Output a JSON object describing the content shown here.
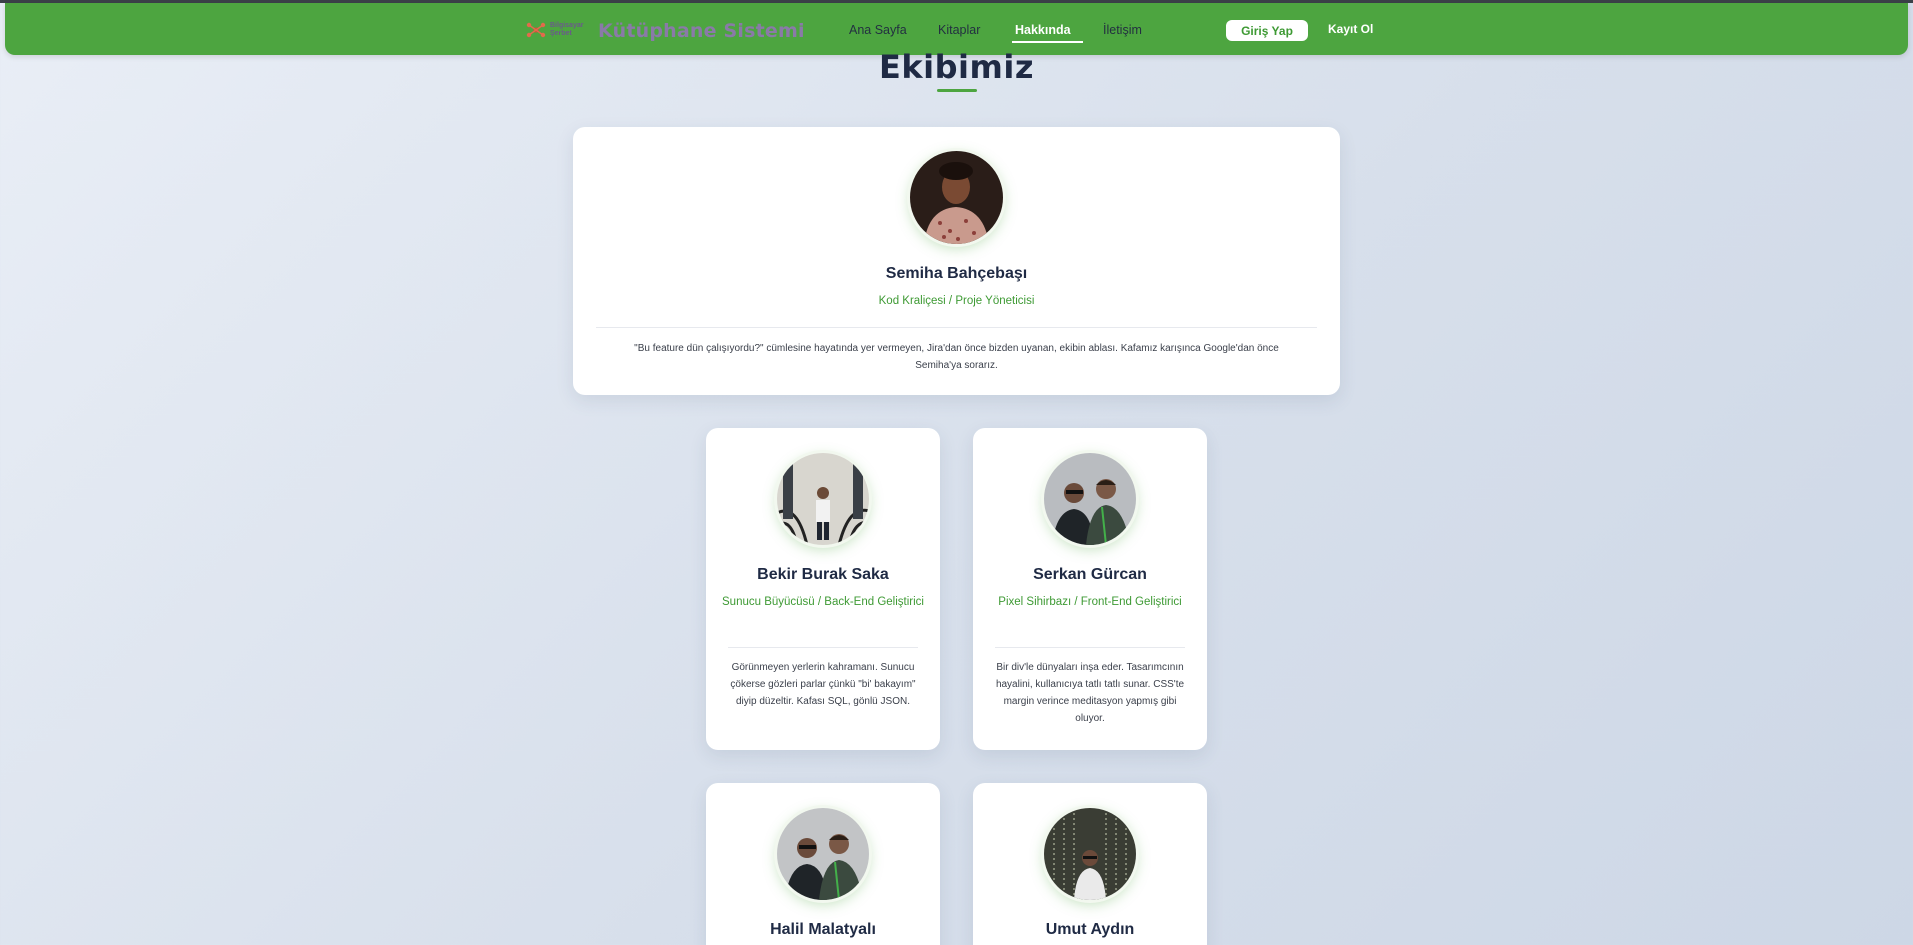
{
  "header": {
    "logo_text": "Bilgisayar Şerbet",
    "brand": "Kütüphane Sistemi",
    "nav": [
      {
        "label": "Ana Sayfa"
      },
      {
        "label": "Kitaplar"
      },
      {
        "label": "Hakkında",
        "active": true
      },
      {
        "label": "İletişim"
      }
    ],
    "login_label": "Giriş Yap",
    "register_label": "Kayıt Ol",
    "brand_color": "#4da540"
  },
  "section": {
    "title": "Ekibimiz"
  },
  "team": [
    {
      "name": "Semiha Bahçebaşı",
      "role": "Kod Kraliçesi / Proje Yöneticisi",
      "bio": "\"Bu feature dün çalışıyordu?\" cümlesine hayatında yer vermeyen, Jira'dan önce bizden uyanan, ekibin ablası. Kafamız karışınca Google'dan önce Semiha'ya sorarız."
    },
    {
      "name": "Bekir Burak Saka",
      "role": "Sunucu Büyücüsü / Back-End Geliştirici",
      "bio": "Görünmeyen yerlerin kahramanı. Sunucu çökerse gözleri parlar çünkü \"bi' bakayım\" diyip düzeltir. Kafası SQL, gönlü JSON."
    },
    {
      "name": "Serkan Gürcan",
      "role": "Pixel Sihirbazı / Front-End Geliştirici",
      "bio": "Bir div'le dünyaları inşa eder. Tasarımcının hayalini, kullanıcıya tatlı tatlı sunar. CSS'te margin verince meditasyon yapmış gibi oluyor."
    },
    {
      "name": "Halil Malatyalı"
    },
    {
      "name": "Umut Aydın"
    }
  ]
}
